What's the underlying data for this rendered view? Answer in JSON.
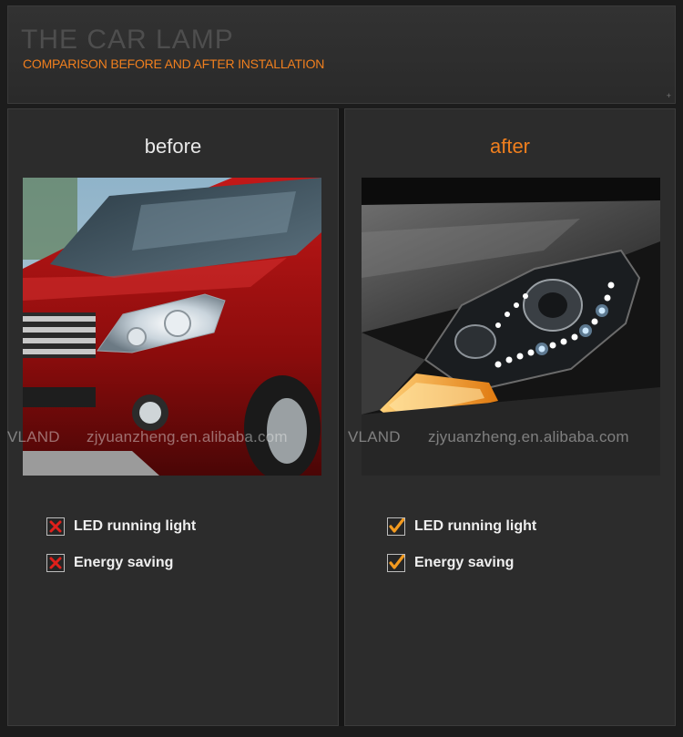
{
  "header": {
    "bg_title": "THE CAR LAMP",
    "subtitle": "COMPARISON BEFORE AND AFTER INSTALLATION",
    "plus": "+"
  },
  "before": {
    "title": "before",
    "photo_desc_icon": "red-suv-halogen-headlight",
    "items": [
      {
        "label": "LED running light",
        "status": "x"
      },
      {
        "label": "Energy saving",
        "status": "x"
      }
    ]
  },
  "after": {
    "title": "after",
    "photo_desc_icon": "grey-car-led-headlight",
    "items": [
      {
        "label": "LED running light",
        "status": "check"
      },
      {
        "label": "Energy saving",
        "status": "check"
      }
    ]
  },
  "watermark": {
    "brand": "VLAND",
    "site": "zjyuanzheng.en.alibaba.com"
  },
  "colors": {
    "accent": "#f07f1e",
    "x_mark": "#e0201b",
    "check_mark": "#f29a1f"
  }
}
